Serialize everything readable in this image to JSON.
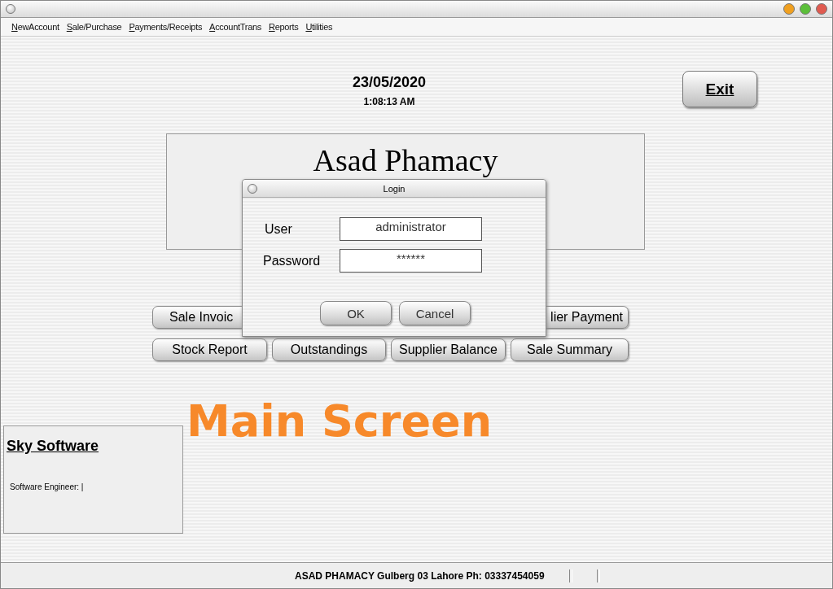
{
  "window": {
    "controls": [
      {
        "color": "#f0a020"
      },
      {
        "color": "#5cbf3a"
      },
      {
        "color": "#e05a50"
      }
    ]
  },
  "menu": [
    "NewAccount",
    "Sale/Purchase",
    "Payments/Receipts",
    "AccountTrans",
    "Reports",
    "Utilities"
  ],
  "header": {
    "date": "23/05/2020",
    "time": "1:08:13 AM",
    "exit_button": "Exit"
  },
  "banner": {
    "title": "Asad Phamacy"
  },
  "buttons": [
    [
      "Sale Invoic",
      "lier Payment"
    ],
    [
      "Stock Report",
      "Outstandings",
      "Supplier Balance",
      "Sale Summary"
    ]
  ],
  "info_panel": {
    "title": "Sky Software",
    "text": "Software Engineer: |"
  },
  "caption": "Main Screen",
  "status_bar": {
    "text": "ASAD PHAMACY Gulberg 03 Lahore Ph: 03337454059"
  },
  "login": {
    "title": "Login",
    "fields": [
      {
        "label": "User",
        "value": "administrator"
      },
      {
        "label": "Password",
        "value": "******"
      }
    ],
    "buttons": [
      "OK",
      "Cancel"
    ]
  }
}
